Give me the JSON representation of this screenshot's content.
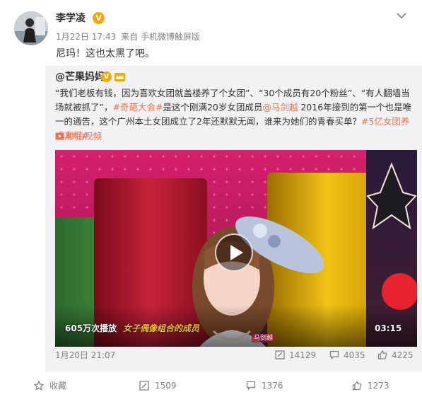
{
  "post": {
    "username": "李学凌",
    "verified_badge": "V",
    "time": "1月22日 17:43",
    "source": "来自 手机微博触屏版",
    "text": "尼玛！这也太黑了吧。"
  },
  "repost": {
    "author": "@芒果妈妈",
    "badge": "V",
    "text_parts": [
      "“我们老板有钱，因为喜欢女团就盖楼养了个女团”、“30个成员有20个粉丝”、“有人翻墙当场就被抓了”，",
      "#奇葩大会#",
      "是这个刚满20岁女团成员",
      "@马剑越",
      " 2016年接到的第一个也是唯一的通告，这个广州本土女团成立了2年还默默无闻，谁来为她们的青春买单？",
      "#5亿女团养成真相#"
    ],
    "video_link": "秒拍视频",
    "video": {
      "plays": "605万次播放",
      "caption": "女子偶像组合的成员",
      "duration": "03:15",
      "watermark": "马剑越"
    },
    "date": "1月20日 21:07",
    "stats": {
      "reposts": "14129",
      "comments": "4035",
      "likes": "4225"
    }
  },
  "actions": {
    "favorite": "收藏",
    "repost": "1509",
    "comment": "1376",
    "like": "1273"
  },
  "icons": {
    "chevron": "chevron-down-icon",
    "video": "video-icon",
    "repost": "repost-icon",
    "comment": "comment-icon",
    "like": "thumbs-up-icon",
    "favorite": "star-icon"
  },
  "colors": {
    "link": "#eb7350",
    "badge": "#f7a800",
    "muted": "#808080"
  }
}
